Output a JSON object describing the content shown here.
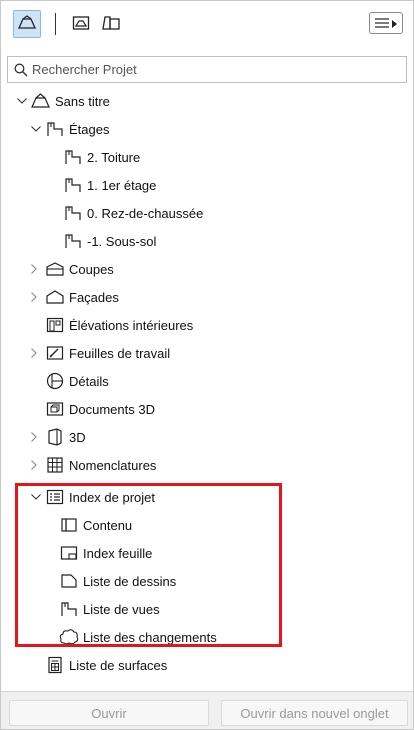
{
  "toolbar": {
    "buttons": [
      {
        "icon": "project-map-icon",
        "active": true
      },
      {
        "icon": "view-map-icon",
        "active": false
      },
      {
        "icon": "layout-book-icon",
        "active": false
      }
    ],
    "menu_icon": "hamburger-menu-icon"
  },
  "search": {
    "placeholder": "Rechercher Projet",
    "value": ""
  },
  "tree": {
    "root": "Sans titre",
    "etages": "Étages",
    "etages_items": [
      "2. Toiture",
      "1. 1er étage",
      "0. Rez-de-chaussée",
      "-1. Sous-sol"
    ],
    "coupes": "Coupes",
    "facades": "Façades",
    "elevations": "Élévations intérieures",
    "feuilles": "Feuilles de travail",
    "details": "Détails",
    "documents3d": "Documents 3D",
    "three_d": "3D",
    "nomenclatures": "Nomenclatures",
    "index": "Index de projet",
    "index_items": [
      "Contenu",
      "Index feuille",
      "Liste de dessins",
      "Liste de vues",
      "Liste des changements"
    ],
    "surfaces": "Liste de surfaces"
  },
  "footer": {
    "open": "Ouvrir",
    "open_new_tab": "Ouvrir dans nouvel onglet"
  },
  "colors": {
    "highlight": "#e8141b",
    "active_button": "#cfe3f7"
  }
}
